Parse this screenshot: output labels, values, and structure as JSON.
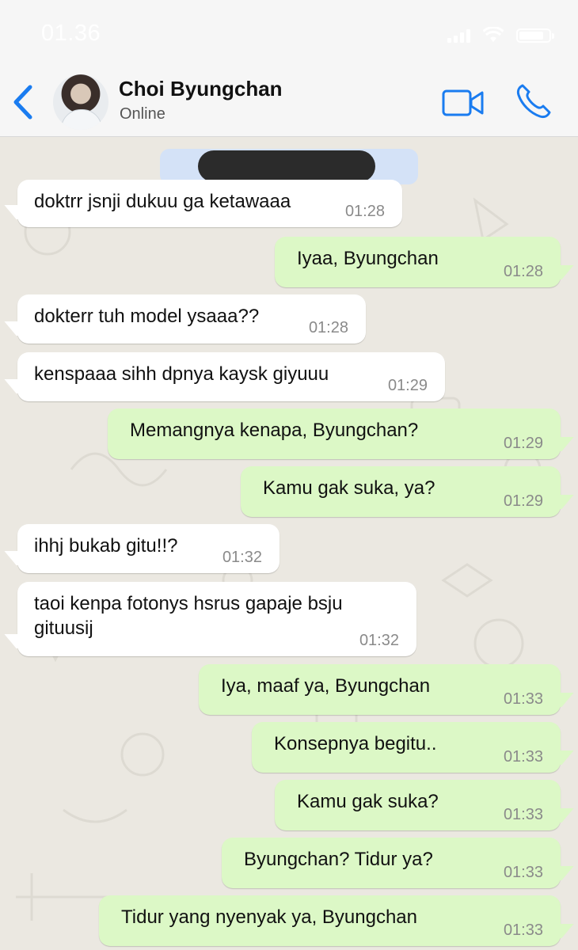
{
  "statusbar": {
    "time": "01.36"
  },
  "header": {
    "back_icon": "chevron-left-icon",
    "contact_name": "Choi Byungchan",
    "contact_status": "Online",
    "video_icon": "video-camera-icon",
    "call_icon": "phone-icon",
    "accent_color": "#1a7cf0"
  },
  "colors": {
    "incoming_bubble": "#ffffff",
    "outgoing_bubble": "#dcf8c6",
    "date_pill": "#d4e2f7"
  },
  "messages": [
    {
      "dir": "in",
      "text": "doktrr jsnji dukuu ga ketawaaa",
      "time": "01:28"
    },
    {
      "dir": "out",
      "text": "Iyaa, Byungchan",
      "time": "01:28"
    },
    {
      "dir": "in",
      "text": "dokterr tuh model ysaaa??",
      "time": "01:28"
    },
    {
      "dir": "in",
      "text": "kenspaaa sihh dpnya kaysk giyuuu",
      "time": "01:29"
    },
    {
      "dir": "out",
      "text": "Memangnya kenapa, Byungchan?",
      "time": "01:29"
    },
    {
      "dir": "out",
      "text": "Kamu gak suka, ya?",
      "time": "01:29"
    },
    {
      "dir": "in",
      "text": "ihhj bukab gitu!!?",
      "time": "01:32"
    },
    {
      "dir": "in",
      "text": "taoi kenpa fotonys hsrus gapaje bsju gituusij",
      "time": "01:32"
    },
    {
      "dir": "out",
      "text": "Iya, maaf ya, Byungchan",
      "time": "01:33"
    },
    {
      "dir": "out",
      "text": "Konsepnya begitu..",
      "time": "01:33"
    },
    {
      "dir": "out",
      "text": "Kamu gak suka?",
      "time": "01:33"
    },
    {
      "dir": "out",
      "text": "Byungchan? Tidur ya?",
      "time": "01:33"
    },
    {
      "dir": "out",
      "text": "Tidur yang nyenyak ya, Byungchan",
      "time": "01:33"
    }
  ]
}
